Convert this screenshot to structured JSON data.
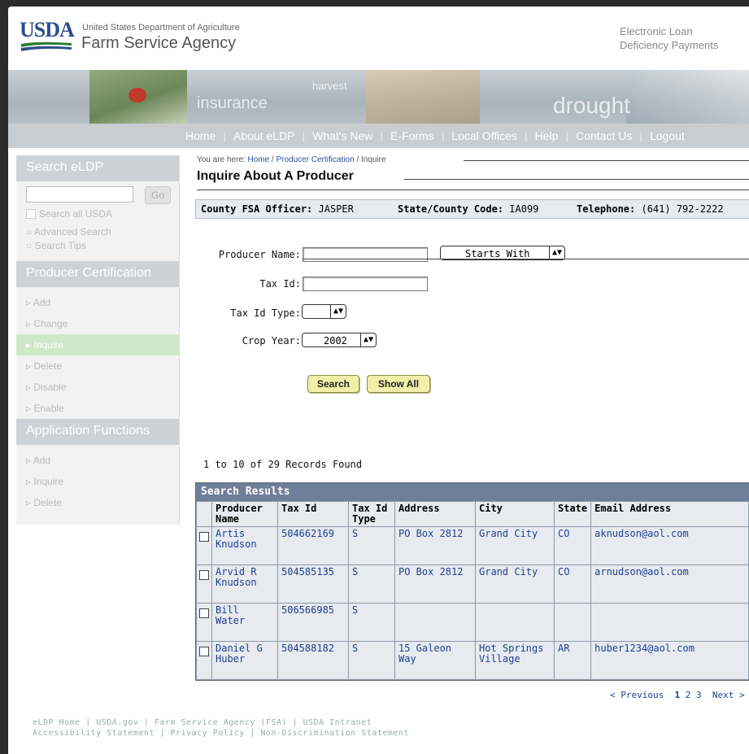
{
  "header": {
    "logo": "USDA",
    "agency_small": "United States Department of Agriculture",
    "agency_big": "Farm Service Agency",
    "app_name_line1": "Electronic Loan",
    "app_name_line2": "Deficiency Payments"
  },
  "banner": {
    "words": [
      "insurance",
      "harvest",
      "drought"
    ]
  },
  "nav": [
    "Home",
    "About eLDP",
    "What's New",
    "E-Forms",
    "Local Offices",
    "Help",
    "Contact Us",
    "Logout"
  ],
  "sidebar": {
    "search_title": "Search eLDP",
    "go_label": "Go",
    "search_all": "Search all USDA",
    "links": [
      "Advanced Search",
      "Search Tips"
    ],
    "producer_cert_title": "Producer Certification",
    "producer_items": [
      "Add",
      "Change",
      "Inquire",
      "Delete",
      "Disable",
      "Enable"
    ],
    "app_functions_title": "Application Functions",
    "app_items": [
      "Add",
      "Inquire",
      "Delete"
    ]
  },
  "breadcrumb": {
    "prefix": "You are here: ",
    "home": "Home",
    "sep": " / ",
    "section": "Producer Certification",
    "current": "Inquire"
  },
  "page_title": "Inquire About A Producer",
  "info": {
    "officer_label": "County FSA Officer:",
    "officer": "JASPER",
    "code_label": "State/County Code:",
    "code": "IA099",
    "phone_label": "Telephone:",
    "phone": "(641) 792-2222"
  },
  "form": {
    "producer_name_label": "Producer Name:",
    "producer_name_value": "",
    "match_mode": "Starts With",
    "tax_id_label": "Tax Id:",
    "tax_id_value": "",
    "tax_id_type_label": "Tax Id Type:",
    "tax_id_type_value": "",
    "crop_year_label": "Crop Year:",
    "crop_year_value": "2002",
    "search_btn": "Search",
    "show_all_btn": "Show All"
  },
  "records_found": "1 to 10 of 29 Records Found",
  "results": {
    "title": "Search Results",
    "columns": [
      "Producer Name",
      "Tax Id",
      "Tax Id Type",
      "Address",
      "City",
      "State",
      "Email Address"
    ],
    "rows": [
      [
        "Artis Knudson",
        "504662169",
        "S",
        "PO Box 2812",
        "Grand City",
        "CO",
        "aknudson@aol.com"
      ],
      [
        "Arvid R Knudson",
        "504585135",
        "S",
        "PO Box 2812",
        "Grand City",
        "CO",
        "arnudson@aol.com"
      ],
      [
        "Bill Water",
        "506566985",
        "S",
        "",
        "",
        "",
        ""
      ],
      [
        "Daniel G Huber",
        "504588182",
        "S",
        "15 Galeon Way",
        "Hot Springs Village",
        "AR",
        "huber1234@aol.com"
      ]
    ]
  },
  "pager": {
    "prev": "< Previous",
    "pages": [
      "1",
      "2",
      "3"
    ],
    "next": "Next >"
  },
  "footer": {
    "line1": "eLDP Home | USDA.gov | Farm Service Agency (FSA) | USDA Intranet",
    "line2": "Accessibility Statement | Privacy Policy | Non-Discrimination Statement"
  }
}
